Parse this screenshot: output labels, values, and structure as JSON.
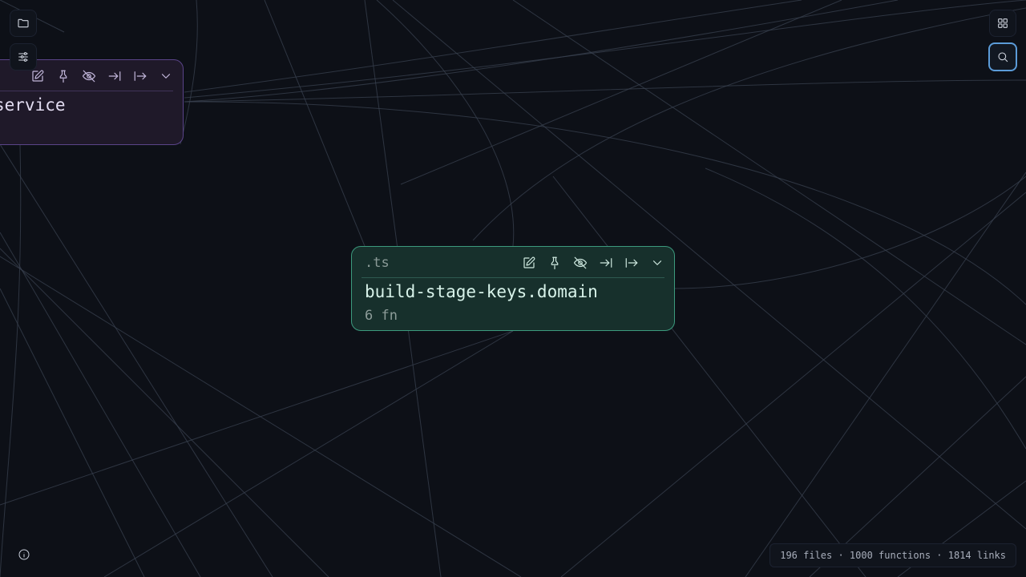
{
  "nodes": {
    "purple": {
      "title": "service"
    },
    "green": {
      "extension": ".ts",
      "title": "build-stage-keys.domain",
      "meta": "6 fn"
    }
  },
  "toolbar": {
    "left": [
      {
        "icon": "folder-icon"
      },
      {
        "icon": "sliders-icon"
      }
    ],
    "right": [
      {
        "icon": "grid-icon"
      },
      {
        "icon": "search-icon",
        "active": true
      }
    ]
  },
  "node_actions": [
    "edit-icon",
    "pin-icon",
    "eye-off-icon",
    "arrow-to-end-icon",
    "arrow-from-start-icon",
    "chevron-down-icon"
  ],
  "status": {
    "text": "196 files · 1000 functions · 1814 links"
  },
  "colors": {
    "background": "#0d1017",
    "edge": "#3a4150",
    "green_node_border": "#3c9a7e",
    "purple_node_border": "#5a4489",
    "active_accent": "#5b9bd8"
  }
}
